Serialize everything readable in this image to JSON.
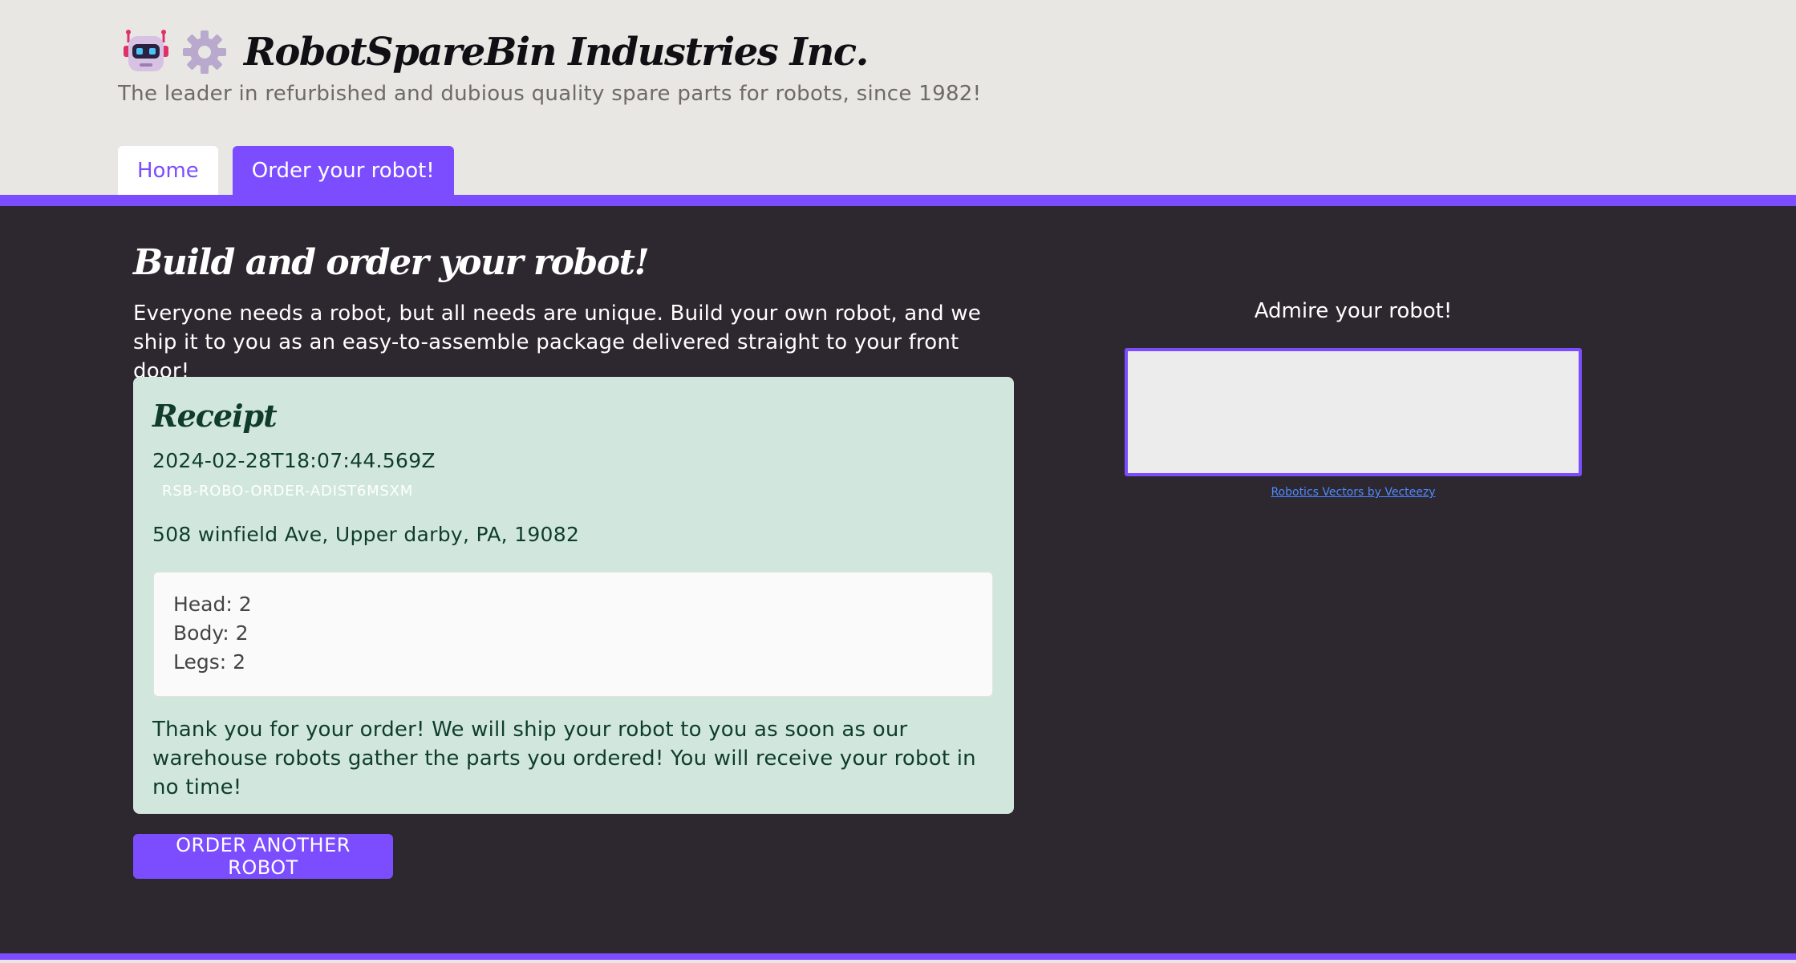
{
  "header": {
    "icons": [
      "robot-face-icon",
      "gear-icon"
    ],
    "title": "RobotSpareBin Industries Inc.",
    "tagline": "The leader in refurbished and dubious quality spare parts for robots, since 1982!"
  },
  "nav": {
    "tabs": [
      {
        "label": "Home",
        "active": false
      },
      {
        "label": "Order your robot!",
        "active": true
      }
    ]
  },
  "main": {
    "title": "Build and order your robot!",
    "intro": "Everyone needs a robot, but all needs are unique. Build your own robot, and we ship it to you as an easy-to-assemble package delivered straight to your front door!"
  },
  "receipt": {
    "title": "Receipt",
    "timestamp": "2024-02-28T18:07:44.569Z",
    "order_id": "RSB-ROBO-ORDER-ADIST6MSXM",
    "address": "508 winfield Ave, Upper darby, PA, 19082",
    "parts": [
      "Head: 2",
      "Body: 2",
      "Legs: 2"
    ],
    "thanks": "Thank you for your order! We will ship your robot to you as soon as our warehouse robots gather the parts you ordered! You will receive your robot in no time!"
  },
  "actions": {
    "order_another": "ORDER ANOTHER ROBOT"
  },
  "preview": {
    "heading": "Admire your robot!",
    "credit": "Robotics Vectors by Vecteezy"
  },
  "colors": {
    "accent": "#7c4dff",
    "dark_bg": "#2d272f",
    "header_bg": "#e8e7e4",
    "receipt_bg": "#d1e7dd"
  }
}
